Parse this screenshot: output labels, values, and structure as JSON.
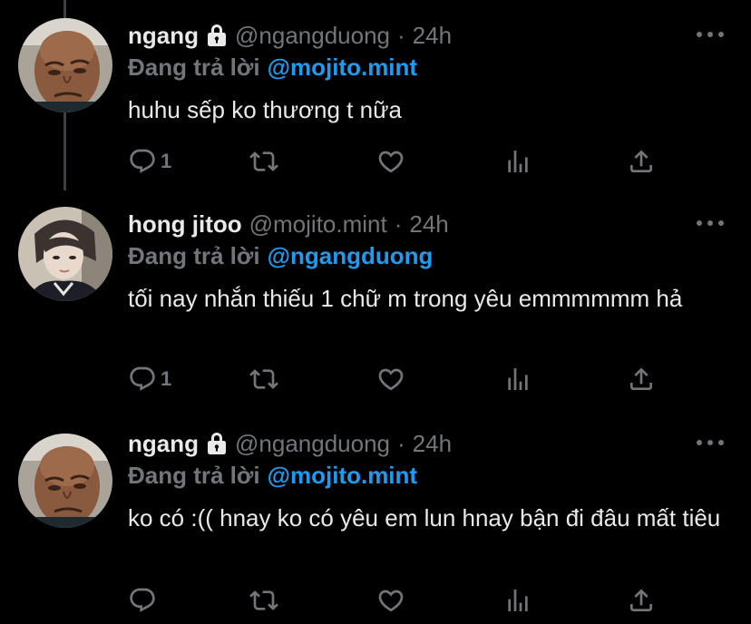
{
  "colors": {
    "background": "#000000",
    "text": "#e7e9ea",
    "secondary": "#71767b",
    "link": "#1d9bf0",
    "thread_line": "#3e4144"
  },
  "tweets": [
    {
      "name": "ngang",
      "protected": true,
      "handle": "@ngangduong",
      "dot": "·",
      "time": "24h",
      "reply_prefix": "Đang trả lời",
      "reply_to": "@mojito.mint",
      "text": "huhu sếp ko thương t nữa",
      "reply_count": "1",
      "avatar_icon": "bald-man-avatar"
    },
    {
      "name": "hong jitoo",
      "protected": false,
      "handle": "@mojito.mint",
      "dot": "·",
      "time": "24h",
      "reply_prefix": "Đang trả lời",
      "reply_to": "@ngangduong",
      "text": "tối nay nhắn thiếu 1 chữ m trong yêu emmmmmm hả",
      "reply_count": "1",
      "avatar_icon": "young-man-avatar"
    },
    {
      "name": "ngang",
      "protected": true,
      "handle": "@ngangduong",
      "dot": "·",
      "time": "24h",
      "reply_prefix": "Đang trả lời",
      "reply_to": "@mojito.mint",
      "text": "ko có :(( hnay ko có yêu em lun hnay bận đi đâu mất tiêu",
      "reply_count": "",
      "avatar_icon": "bald-man-avatar"
    }
  ],
  "icons": [
    "reply-icon",
    "retweet-icon",
    "like-icon",
    "views-icon",
    "share-icon",
    "lock-icon",
    "more-icon"
  ]
}
